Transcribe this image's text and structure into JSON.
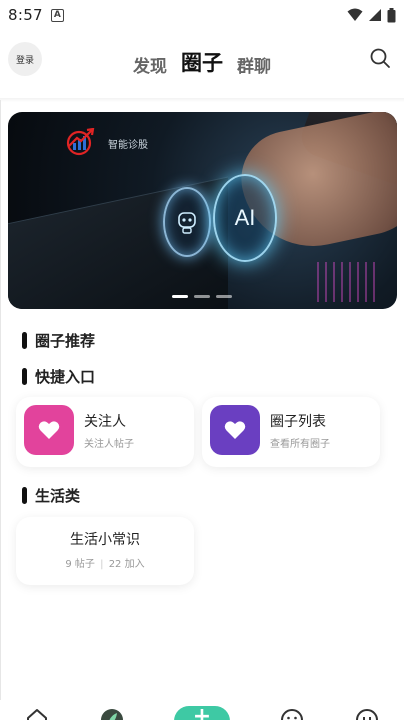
{
  "status_bar": {
    "time": "8:57",
    "notification_letter": "A",
    "icons": [
      "wifi-icon",
      "signal-icon",
      "battery-icon"
    ]
  },
  "header": {
    "login_label": "登录",
    "tabs": [
      {
        "label": "发现",
        "active": false
      },
      {
        "label": "圈子",
        "active": true
      },
      {
        "label": "群聊",
        "active": false
      }
    ],
    "search_icon": "search-icon"
  },
  "banner": {
    "logo_text": "智能诊股",
    "ai_text": "AI",
    "dot_count": 3,
    "active_dot": 0
  },
  "sections": {
    "recommend_title": "圈子推荐",
    "quick_title": "快捷入口",
    "life_title": "生活类"
  },
  "quick_entries": [
    {
      "title": "关注人",
      "subtitle": "关注人帖子",
      "icon": "heart-icon",
      "color": "#e2439c"
    },
    {
      "title": "圈子列表",
      "subtitle": "查看所有圈子",
      "icon": "heart-icon",
      "color": "#6a3fc1"
    }
  ],
  "life_circle": {
    "title": "生活小常识",
    "posts": "9 帖子",
    "separator": "|",
    "joined": "22 加入"
  },
  "bottom_nav": {
    "items": [
      "home-icon",
      "leaf-icon",
      "add-icon",
      "smile-icon",
      "profile-icon"
    ],
    "accent": "#3ec9a4",
    "plus_label": "+"
  }
}
